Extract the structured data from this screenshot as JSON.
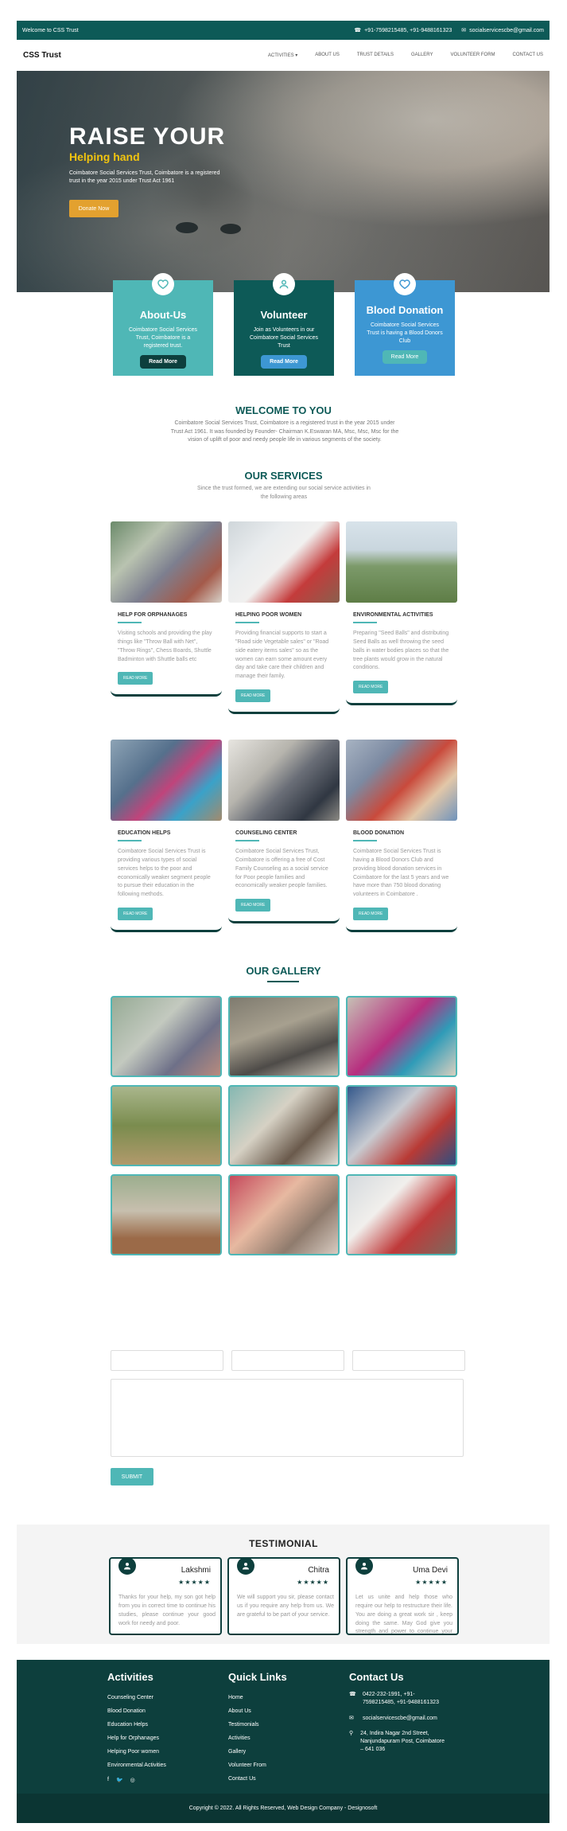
{
  "topbar": {
    "welcome": "Welcome to CSS Trust",
    "phone": "+91-7598215485, +91-9488161323",
    "email": "socialservicescbe@gmail.com"
  },
  "nav": {
    "brand": "CSS Trust",
    "items": [
      "ACTIVITIES",
      "ABOUT US",
      "TRUST DETAILS",
      "GALLERY",
      "VOLUNTEER FORM",
      "CONTACT US"
    ]
  },
  "hero": {
    "title": "RAISE YOUR",
    "subtitle": "Helping hand",
    "text": "Coimbatore Social Services Trust, Coimbatore is a registered trust in the year 2015 under Trust Act 1961",
    "button": "Donate Now"
  },
  "features": [
    {
      "title": "About-Us",
      "text": "Coimbatore Social Services Trust, Coimbatore is a registered trust.",
      "button": "Read More"
    },
    {
      "title": "Volunteer",
      "text": "Join as Volunteers in our Coimbatore Social Services Trust",
      "button": "Read More"
    },
    {
      "title": "Blood Donation",
      "text": "Coimbatore Social Services Trust is having a Blood Donors Club",
      "button": "Read More"
    }
  ],
  "welcome": {
    "title": "WELCOME TO YOU",
    "text": "Coimbatore Social Services Trust, Coimbatore is a registered trust in the year 2015 under Trust Act 1961. It was founded by Founder- Chairman K.Eswaran MA, Msc, Msc, Msc for the vision of uplift of poor and needy people life in various segments of the society."
  },
  "services": {
    "title": "OUR SERVICES",
    "text": "Since the trust formed, we are extending our social service activities in the following areas",
    "read_more": "READ MORE",
    "items": [
      {
        "title": "HELP FOR ORPHANAGES",
        "text": "Visiting schools and providing the play things like \"Throw Ball with Net\", \"Throw Rings\", Chess Boards, Shuttle Badminton with Shuttle balls etc"
      },
      {
        "title": "HELPING POOR WOMEN",
        "text": "Providing financial supports to start a \"Road side Vegetable sales\" or \"Road side eatery items sales\" so as the women can earn some amount every day and take care their children and manage their family."
      },
      {
        "title": "ENVIRONMENTAL ACTIVITIES",
        "text": "Preparing \"Seed Balls\" and distributing Seed Balls as well throwing the seed balls in water bodies places so that the tree plants would grow in the natural conditions."
      },
      {
        "title": "EDUCATION HELPS",
        "text": "Coimbatore Social Services Trust is providing various types of social services helps to the poor and economically weaker segment people to pursue their education in the following methods."
      },
      {
        "title": "COUNSELING CENTER",
        "text": "Coimbatore Social Services Trust, Coimbatore is offering a free of Cost Family Counseling as a social service for Poor people families and economically weaker people families."
      },
      {
        "title": "BLOOD DONATION",
        "text": "Coimbatore Social Services Trust is having a Blood Donors Club and providing blood donation services in Coimbatore for the last 5 years and we have more than 750 blood donating volunteers in Coimbatore ."
      }
    ]
  },
  "gallery": {
    "title": "OUR GALLERY"
  },
  "form": {
    "submit": "SUBMIT"
  },
  "testimonial": {
    "title": "TESTIMONIAL",
    "items": [
      {
        "name": "Lakshmi",
        "stars": "★★★★★",
        "text": "Thanks for your help, my son got help from you in correct time to continue his studies, please continue your good work for needy and poor."
      },
      {
        "name": "Chitra",
        "stars": "★★★★★",
        "text": "We will support you sir, please contact us if you require any help from us. We are grateful to be part of your service."
      },
      {
        "name": "Uma Devi",
        "stars": "★★★★★",
        "text": "Let us unite and help those who require our help to restructure their life. You are doing a great work sir , keep doing the same. May God give you strength and power to continue your service."
      }
    ]
  },
  "footer": {
    "activities": {
      "title": "Activities",
      "items": [
        "Counseling Center",
        "Blood Donation",
        "Education Helps",
        "Help for Orphanages",
        "Helping Poor women",
        "Environmental Activities"
      ]
    },
    "links": {
      "title": "Quick Links",
      "items": [
        "Home",
        "About Us",
        "Testimonials",
        "Activities",
        "Gallery",
        "Volunteer From",
        "Contact Us"
      ]
    },
    "contact": {
      "title": "Contact Us",
      "phone": "0422-232-1991, +91-7598215485, +91-9488161323",
      "email": "socialservicescbe@gmail.com",
      "address": "24, Indira Nagar 2nd Street, Nanjundapuram Post, Coimbatore – 641 036"
    },
    "copyright": "Copyright © 2022. All Rights Reserved, Web Design Company - Designosoft"
  },
  "colors": {
    "primary": "#0d5a57",
    "accent": "#4fb7b6",
    "blue": "#3d97d3",
    "donate": "#e3a12f",
    "footer": "#0d3f3d"
  }
}
